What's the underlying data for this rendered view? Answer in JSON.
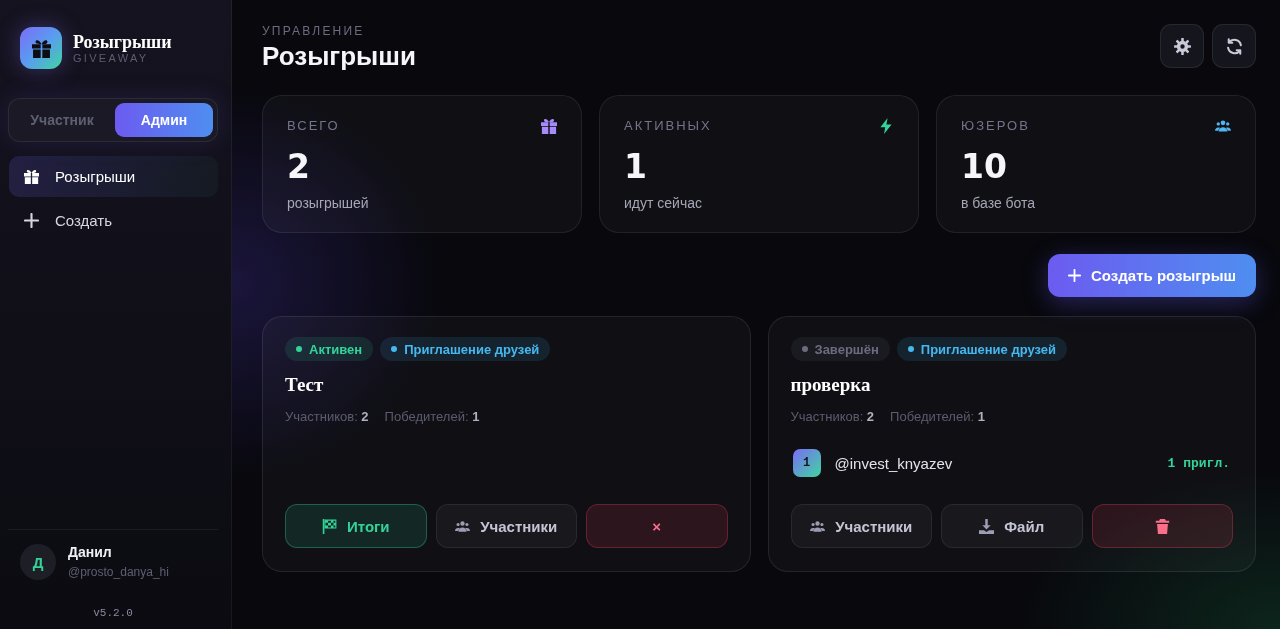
{
  "sidebar": {
    "brand": {
      "title": "Розыгрыши",
      "subtitle": "GIVEAWAY"
    },
    "roles": [
      {
        "label": "Участник",
        "selected": false
      },
      {
        "label": "Админ",
        "selected": true
      }
    ],
    "nav": [
      {
        "kind": "giveaways",
        "label": "Розыгрыши",
        "selected": true
      },
      {
        "kind": "create",
        "label": "Создать",
        "selected": false
      }
    ],
    "user": {
      "initial": "Д",
      "name": "Данил",
      "handle": "@prosto_danya_hi"
    },
    "version": "v5.2.0"
  },
  "header": {
    "eyebrow": "УПРАВЛЕНИЕ",
    "title": "Розыгрыши",
    "actions": [
      {
        "kind": "settings"
      },
      {
        "kind": "refresh"
      }
    ]
  },
  "stats": [
    {
      "kind": "gift",
      "label": "ВСЕГО",
      "value": "2",
      "caption": "розыгрышей",
      "color": "#a78bfa"
    },
    {
      "kind": "bolt",
      "label": "АКТИВНЫХ",
      "value": "1",
      "caption": "идут сейчас",
      "color": "#34d399"
    },
    {
      "kind": "users",
      "label": "ЮЗЕРОВ",
      "value": "10",
      "caption": "в базе бота",
      "color": "#4fb6f2"
    }
  ],
  "create_button": {
    "label": "Создать розыгрыш"
  },
  "giveaways": [
    {
      "tags": [
        {
          "label": "Активен",
          "color": "#34d399"
        },
        {
          "label": "Приглашение друзей",
          "color": "#45b8f0"
        }
      ],
      "title": "Тест",
      "meta": [
        "Участников: **2**",
        "Победителей: **1**"
      ],
      "buttons": [
        {
          "kind": "results",
          "label": "Итоги"
        },
        {
          "kind": "participants",
          "label": "Участники"
        },
        {
          "kind": "close",
          "label": "×"
        }
      ]
    },
    {
      "tags": [
        {
          "label": "Завершён",
          "color": "#6b6b80"
        },
        {
          "label": "Приглашение друзей",
          "color": "#45b8f0"
        }
      ],
      "title": "проверка",
      "meta": [
        "Участников: **2**",
        "Победителей: **1**"
      ],
      "winners": [
        {
          "rank": "1",
          "handle": "@invest_knyazev",
          "invites": "1 пригл."
        }
      ],
      "buttons": [
        {
          "kind": "participants",
          "label": "Участники"
        },
        {
          "kind": "file",
          "label": "Файл"
        },
        {
          "kind": "delete"
        }
      ]
    }
  ]
}
